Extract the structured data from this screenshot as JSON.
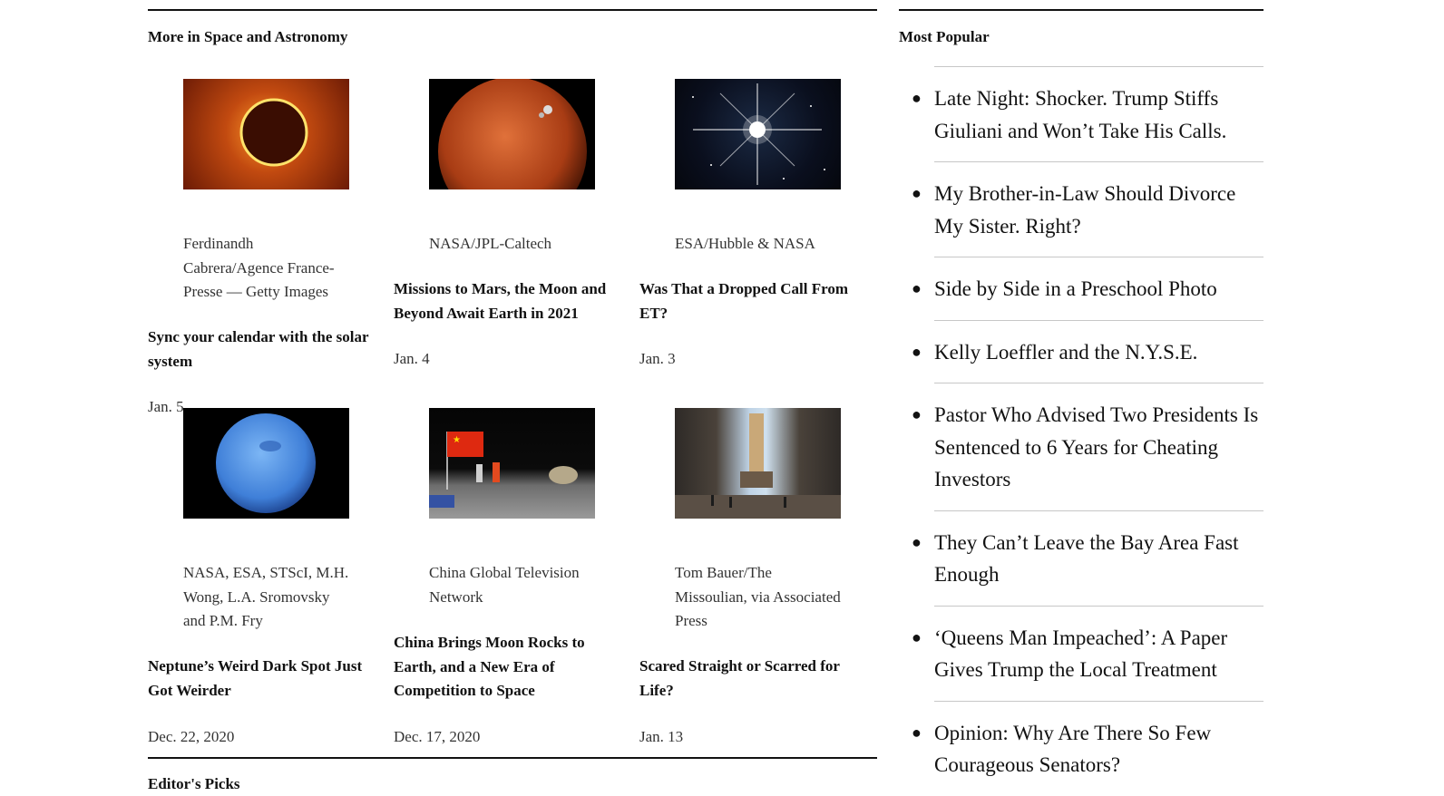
{
  "more_section": {
    "title": "More in Space and Astronomy",
    "cards": [
      {
        "credit": "Ferdinandh Cabrera/Agence France-Presse — Getty Images",
        "headline": "Sync your calendar with the solar system",
        "date": "Jan. 5",
        "image": "annular-eclipse-photo"
      },
      {
        "credit": "NASA/JPL-Caltech",
        "headline": "Missions to Mars, the Moon and Beyond Await Earth in 2021",
        "date": "Jan. 4",
        "image": "mars-with-spacecraft-illustration"
      },
      {
        "credit": "ESA/Hubble & NASA",
        "headline": "Was That a Dropped Call From ET?",
        "date": "Jan. 3",
        "image": "bright-star-photo"
      },
      {
        "credit": "NASA, ESA, STScI, M.H. Wong, L.A. Sromovsky and P.M. Fry",
        "headline": "Neptune’s Weird Dark Spot Just Got Weirder",
        "date": "Dec. 22, 2020",
        "image": "neptune-photo"
      },
      {
        "credit": "China Global Television Network",
        "headline": "China Brings Moon Rocks to Earth, and a New Era of Competition to Space",
        "date": "Dec. 17, 2020",
        "image": "capsule-landing-flag-photo"
      },
      {
        "credit": "Tom Bauer/The Missoulian, via Associated Press",
        "headline": "Scared Straight or Scarred for Life?",
        "date": "Jan. 13",
        "image": "rocket-hangar-photo"
      }
    ]
  },
  "editors_picks": {
    "title": "Editor's Picks"
  },
  "most_popular": {
    "title": "Most Popular",
    "items": [
      "Late Night: Shocker. Trump Stiffs Giuliani and Won’t Take His Calls.",
      "My Brother-in-Law Should Divorce My Sister. Right?",
      "Side by Side in a Preschool Photo",
      "Kelly Loeffler and the N.Y.S.E.",
      "Pastor Who Advised Two Presidents Is Sentenced to 6 Years for Cheating Investors",
      "They Can’t Leave the Bay Area Fast Enough",
      "‘Queens Man Impeached’: A Paper Gives Trump the Local Treatment",
      "Opinion: Why Are There So Few Courageous Senators?"
    ]
  },
  "colors": {
    "text": "#121212",
    "rule": "#121212",
    "divider": "#c7c7c7"
  }
}
